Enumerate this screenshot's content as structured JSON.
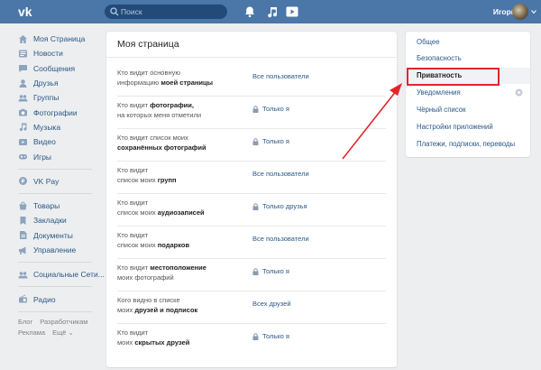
{
  "header": {
    "logo_icon": "vk-logo-icon",
    "search_placeholder": "Поиск",
    "user_name": "Игорь",
    "icons": [
      "bell-icon",
      "music-note-icon",
      "play-icon"
    ]
  },
  "sidebar": {
    "group1": [
      {
        "label": "Моя Страница",
        "icon": "home-icon"
      },
      {
        "label": "Новости",
        "icon": "news-icon"
      },
      {
        "label": "Сообщения",
        "icon": "message-icon"
      },
      {
        "label": "Друзья",
        "icon": "user-icon"
      },
      {
        "label": "Группы",
        "icon": "group-icon"
      },
      {
        "label": "Фотографии",
        "icon": "camera-icon"
      },
      {
        "label": "Музыка",
        "icon": "music-icon"
      },
      {
        "label": "Видео",
        "icon": "video-icon"
      },
      {
        "label": "Игры",
        "icon": "games-icon"
      }
    ],
    "group2": [
      {
        "label": "VK Pay",
        "icon": "vkpay-icon"
      }
    ],
    "group3": [
      {
        "label": "Товары",
        "icon": "shopping-icon"
      },
      {
        "label": "Закладки",
        "icon": "bookmark-icon"
      },
      {
        "label": "Документы",
        "icon": "document-icon"
      },
      {
        "label": "Управление",
        "icon": "megaphone-icon"
      }
    ],
    "group4": [
      {
        "label": "Социальные Сети...",
        "icon": "social-icon"
      }
    ],
    "group5": [
      {
        "label": "Радио",
        "icon": "radio-icon"
      }
    ],
    "footer": {
      "blog": "Блог",
      "devs": "Разработчикам",
      "ads": "Реклама",
      "more": "Ещё ⌄"
    }
  },
  "main": {
    "title": "Моя страница",
    "rows": [
      {
        "q1": "Кто видит основную",
        "q2": "информацию ",
        "q2b": "моей страницы",
        "value": "Все пользователи",
        "locked": false
      },
      {
        "q1": "Кто видит ",
        "q1b": "фотографии,",
        "q2": "на которых меня отметили",
        "value": "Только я",
        "locked": true
      },
      {
        "q1": "Кто видит список моих",
        "q2b": "сохранённых фотографий",
        "value": "Только я",
        "locked": true
      },
      {
        "q1": "Кто видит",
        "q2": "список моих ",
        "q2b": "групп",
        "value": "Все пользователи",
        "locked": false
      },
      {
        "q1": "Кто видит",
        "q2": "список моих ",
        "q2b": "аудиозаписей",
        "value": "Только друзья",
        "locked": true
      },
      {
        "q1": "Кто видит",
        "q2": "список моих ",
        "q2b": "подарков",
        "value": "Все пользователи",
        "locked": false
      },
      {
        "q1": "Кто видит ",
        "q1b": "местоположение",
        "q2": "моих фотографий",
        "value": "Только я",
        "locked": true
      },
      {
        "q1": "Кого видно в списке",
        "q2": "моих ",
        "q2b": "друзей и подписок",
        "value": "Всех друзей",
        "locked": false
      },
      {
        "q1": "Кто видит",
        "q2": "моих ",
        "q2b": "скрытых друзей",
        "value": "Только я",
        "locked": true
      }
    ]
  },
  "settings_menu": {
    "items": [
      {
        "label": "Общее",
        "active": false
      },
      {
        "label": "Безопасность",
        "active": false
      },
      {
        "label": "Приватность",
        "active": true
      },
      {
        "label": "Уведомления",
        "active": false
      },
      {
        "label": "Чёрный список",
        "active": false
      },
      {
        "label": "Настройки приложений",
        "active": false
      },
      {
        "label": "Платежи, подписки, переводы",
        "active": false
      }
    ]
  },
  "colors": {
    "header": "#4a76a8",
    "link": "#2a5885",
    "highlight": "#e3242b",
    "background": "#edeef0"
  }
}
